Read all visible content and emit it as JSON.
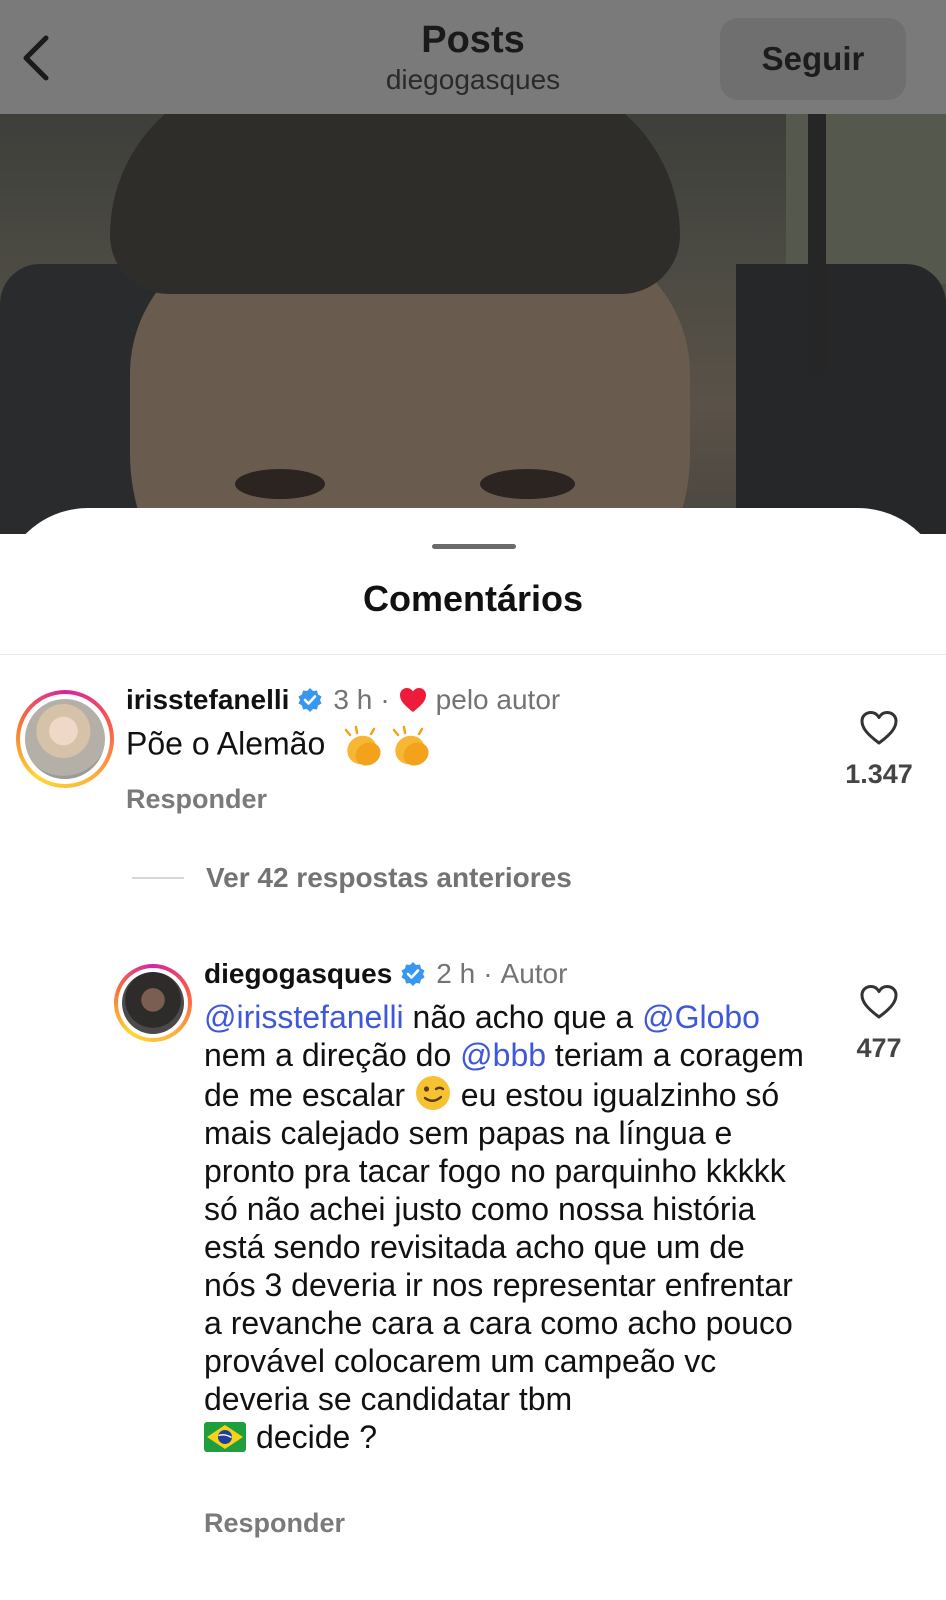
{
  "header": {
    "title": "Posts",
    "subtitle": "diegogasques",
    "follow_label": "Seguir"
  },
  "sheet": {
    "title": "Comentários"
  },
  "comments": [
    {
      "username": "irisstefanelli",
      "time": "3 h",
      "separator": "·",
      "liked_by_author_label": "pelo autor",
      "text": "Põe o Alemão",
      "reply_label": "Responder",
      "like_count": "1.347"
    },
    {
      "username": "diegogasques",
      "time": "2 h",
      "separator": "·",
      "author_label": "Autor",
      "text_parts": {
        "mention1": "@irisstefanelli",
        "t1": " não acho que a ",
        "mention2": "@Globo",
        "t2": " nem a direção do ",
        "mention3": "@bbb",
        "t3": " teriam a coragem de me escalar ",
        "t4": " eu estou igualzinho só mais calejado sem papas na língua e pronto pra tacar fogo no parquinho kkkkk só não achei justo como nossa história está sendo revisitada acho que um de nós 3 deveria ir nos representar enfrentar a revanche cara a cara como acho pouco provável colocarem um campeão vc deveria se candidatar tbm",
        "t5": "decide ?"
      },
      "reply_label": "Responder",
      "like_count": "477"
    }
  ],
  "view_more_replies_label": "Ver 42 respostas anteriores",
  "colors": {
    "mention": "#3f58d9",
    "verified": "#3897f0",
    "heart_author": "#ed1c3b"
  }
}
